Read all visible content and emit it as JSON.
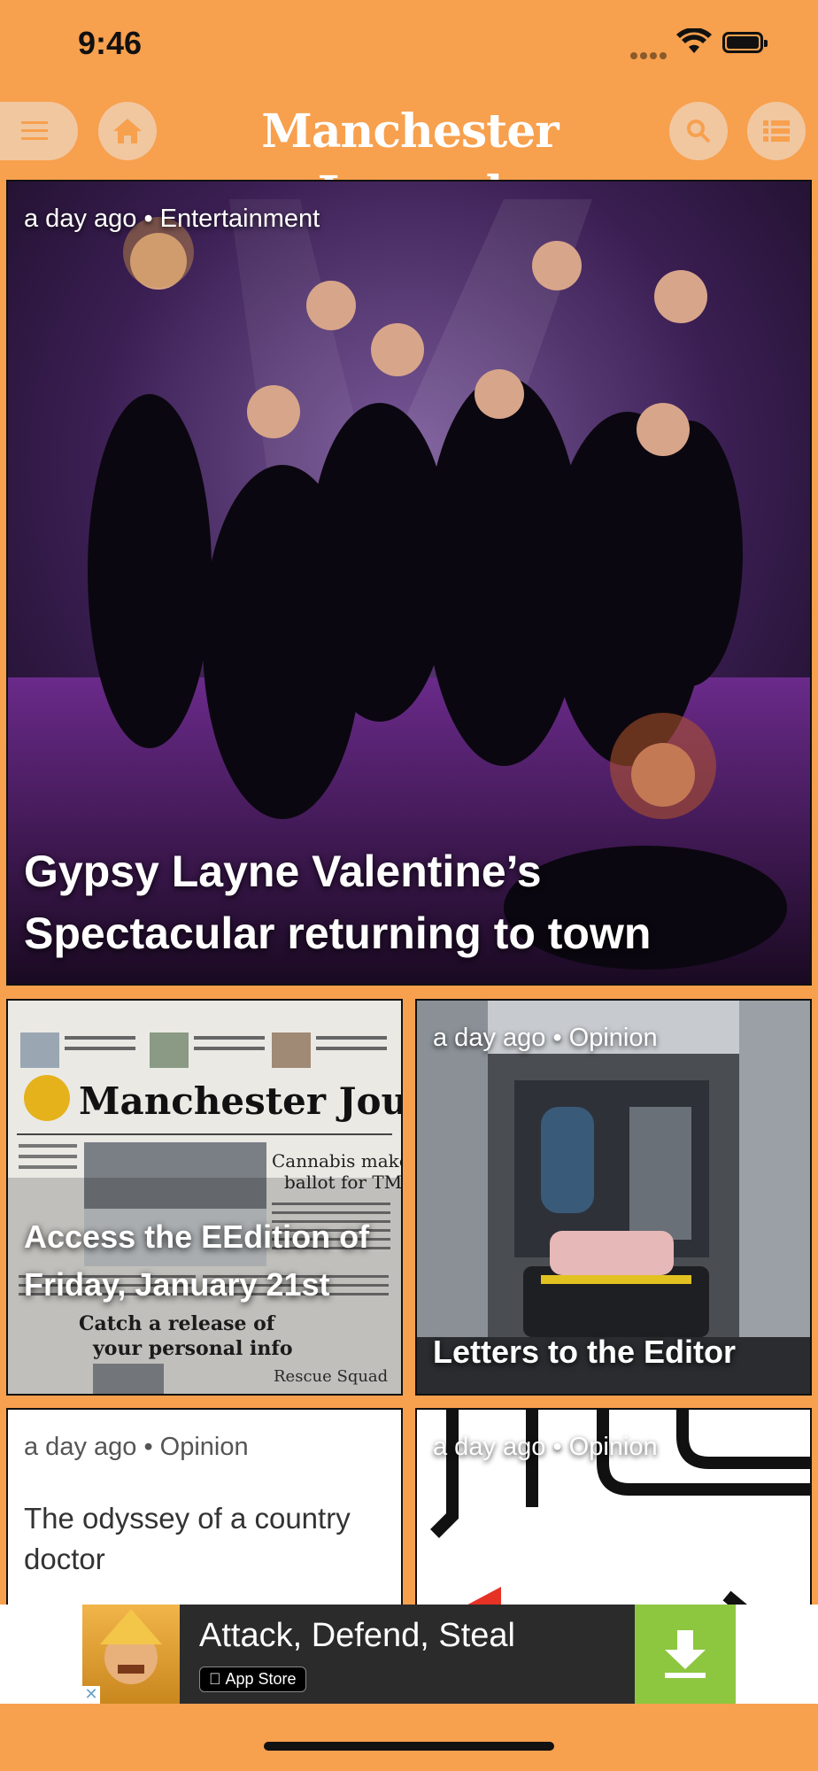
{
  "status": {
    "time": "9:46"
  },
  "header": {
    "logo": "Manchester Journal"
  },
  "hero": {
    "meta": "a day ago • Entertainment",
    "title": "Gypsy Layne Valentine’s Spectacular returning to town"
  },
  "cards": [
    {
      "meta": "",
      "title": "Access the EEdition of Friday, January 21st"
    },
    {
      "meta": "a day ago • Opinion",
      "title": "Letters to the Editor"
    },
    {
      "meta": "a day ago • Opinion",
      "title": "The odyssey of a country doctor"
    },
    {
      "meta": "a day ago • Opinion",
      "title": ""
    }
  ],
  "ad": {
    "headline": "Attack, Defend, Steal",
    "store": "App Store"
  },
  "colors": {
    "brand": "#f7a04e",
    "button_bg": "#f1c7a0",
    "ad_download": "#8dc63f"
  }
}
